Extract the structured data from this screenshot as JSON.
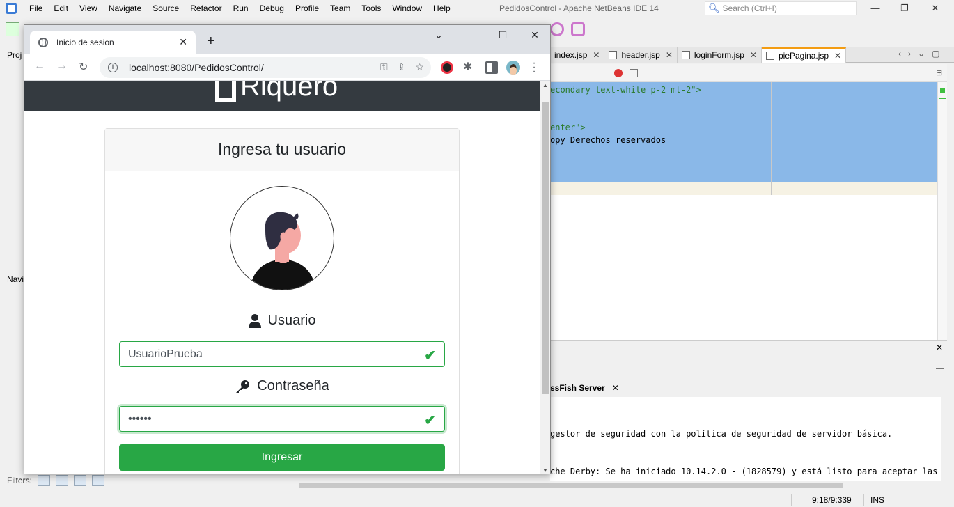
{
  "ide": {
    "title": "PedidosControl - Apache NetBeans IDE 14",
    "menu": [
      "File",
      "Edit",
      "View",
      "Navigate",
      "Source",
      "Refactor",
      "Run",
      "Debug",
      "Profile",
      "Team",
      "Tools",
      "Window",
      "Help"
    ],
    "search_placeholder": "Search (Ctrl+I)",
    "tabs": [
      {
        "label": "index.jsp"
      },
      {
        "label": "header.jsp"
      },
      {
        "label": "loginForm.jsp"
      },
      {
        "label": "piePagina.jsp",
        "active": true
      }
    ],
    "code_lines": [
      {
        "text": "econdary text-white p-2 mt-2\">"
      },
      {
        "text": "enter\">"
      },
      {
        "text": "opy Derechos reservados"
      }
    ],
    "output_tab": "ssFish Server",
    "output_lines": [
      "gestor de seguridad con la política de seguridad de servidor básica.",
      "che Derby: Se ha iniciado 10.14.2.0 - (1828579) y está listo para aceptar las con"
    ],
    "left_labels": {
      "projects": "Proj",
      "navigator": "Navi"
    },
    "filters_label": "Filters:",
    "status_position": "9:18/9:339",
    "status_mode": "INS"
  },
  "browser": {
    "tab_title": "Inicio de sesion",
    "url": "localhost:8080/PedidosControl/"
  },
  "page": {
    "brand": "Riquero",
    "card_title": "Ingresa tu usuario",
    "usuario_label": "Usuario",
    "usuario_value": "UsuarioPrueba",
    "password_label": "Contraseña",
    "password_value": "••••••",
    "submit_label": "Ingresar",
    "colors": {
      "success": "#28a745",
      "navbar": "#343a40"
    }
  }
}
